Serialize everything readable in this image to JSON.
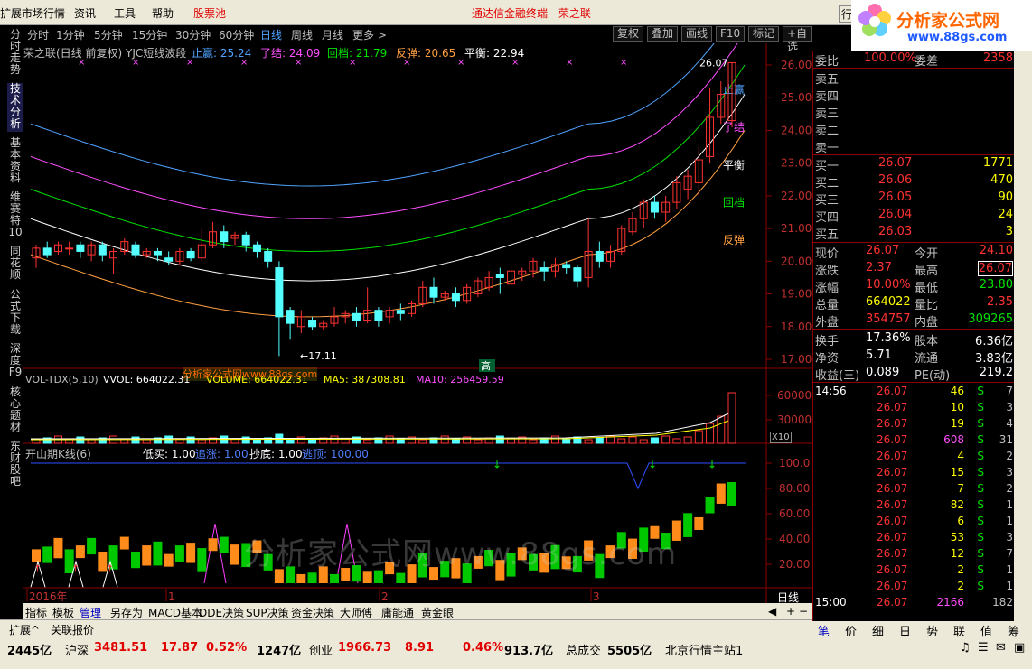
{
  "menubar": {
    "items": [
      "扩展市场行情",
      "资讯",
      "工具",
      "帮助",
      "股票池"
    ],
    "center_text": "通达信金融终端",
    "stock_name": "荣之联",
    "trade_btn": "行",
    "logo_text": "分析家公式网",
    "logo_url": "www.88gs.com"
  },
  "left_tabs": [
    "分时走势",
    "技术分析",
    "基本资料",
    "维赛特10",
    "同花顺",
    "公式下载",
    "深度F9",
    "核心题材",
    "东财股吧"
  ],
  "toolbar": {
    "periods": [
      "分时",
      "1分钟",
      "5分钟",
      "15分钟",
      "30分钟",
      "60分钟",
      "日线",
      "周线",
      "月线",
      "更多 >"
    ],
    "active": "日线",
    "buttons": [
      "复权",
      "叠加",
      "画线",
      "F10",
      "标记",
      "+自选"
    ]
  },
  "main_chart": {
    "title": "荣之联(日线 前复权) YJC短线波段",
    "legend": [
      {
        "label": "止赢: 25.24",
        "color": "#4fa3ff"
      },
      {
        "label": "了结: 24.09",
        "color": "#ff4fff"
      },
      {
        "label": "回档: 21.79",
        "color": "#00e000"
      },
      {
        "label": "反弹: 20.65",
        "color": "#ffa040"
      },
      {
        "label": "平衡: 22.94",
        "color": "#ffffff"
      }
    ],
    "y_ticks": [
      "26.00",
      "25.00",
      "24.00",
      "23.00",
      "22.00",
      "21.00",
      "20.00",
      "19.00",
      "18.00",
      "17.00"
    ],
    "line_labels": [
      "止赢",
      "了结",
      "平衡",
      "回档",
      "反弹"
    ],
    "high_label": "26.07",
    "low_label": "17.11",
    "marker_label": "高",
    "watermark": "分析家公式网www.88gs.com"
  },
  "vol_chart": {
    "legend": [
      "VOL-TDX(5,10)",
      "VVOL: 664022.31",
      "VOLUME: 664022.31",
      "MA5: 387308.81",
      "MA10: 256459.59"
    ],
    "y_ticks": [
      "60000",
      "30000"
    ],
    "unit": "X10"
  },
  "ind_chart": {
    "title": "开山期K线(6)",
    "legend": [
      {
        "label": "低买: 1.00",
        "color": "#ffffff"
      },
      {
        "label": "追涨: 1.00",
        "color": "#4f7fff"
      },
      {
        "label": "抄底: 1.00",
        "color": "#ffffff"
      },
      {
        "label": "逃顶: 100.00",
        "color": "#4f7fff"
      }
    ],
    "y_ticks": [
      "100.0",
      "80.00",
      "60.00",
      "40.00",
      "20.00"
    ]
  },
  "xaxis": {
    "labels": [
      "2016年",
      "1",
      "2",
      "3"
    ],
    "period": "日线"
  },
  "bottom_tabs": [
    "指标",
    "模板",
    "管理",
    "另存为",
    "MACD基本",
    "DDE决策",
    "SUP决策",
    "资金决策",
    "大师傅",
    "庸能通",
    "黄金眼"
  ],
  "bottom_tabs2": [
    "扩展^",
    "关联报价"
  ],
  "quote": {
    "weibi_label": "委比",
    "weibi": "100.00%",
    "weicha_label": "委差",
    "weicha": "2358",
    "sell": [
      {
        "name": "卖五",
        "price": "",
        "vol": ""
      },
      {
        "name": "卖四",
        "price": "",
        "vol": ""
      },
      {
        "name": "卖三",
        "price": "",
        "vol": ""
      },
      {
        "name": "卖二",
        "price": "",
        "vol": ""
      },
      {
        "name": "卖一",
        "price": "",
        "vol": ""
      }
    ],
    "buy": [
      {
        "name": "买一",
        "price": "26.07",
        "vol": "1771"
      },
      {
        "name": "买二",
        "price": "26.06",
        "vol": "470"
      },
      {
        "name": "买三",
        "price": "26.05",
        "vol": "90"
      },
      {
        "name": "买四",
        "price": "26.04",
        "vol": "24"
      },
      {
        "name": "买五",
        "price": "26.03",
        "vol": "3"
      }
    ],
    "stats": [
      {
        "l1": "现价",
        "v1": "26.07",
        "l2": "今开",
        "v2": "24.10"
      },
      {
        "l1": "涨跌",
        "v1": "2.37",
        "l2": "最高",
        "v2": "26.07"
      },
      {
        "l1": "涨幅",
        "v1": "10.00%",
        "l2": "最低",
        "v2": "23.80"
      },
      {
        "l1": "总量",
        "v1": "664022",
        "l2": "量比",
        "v2": "2.35"
      },
      {
        "l1": "外盘",
        "v1": "354757",
        "l2": "内盘",
        "v2": "309265"
      }
    ],
    "stats2": [
      {
        "l1": "换手",
        "v1": "17.36%",
        "l2": "股本",
        "v2": "6.36亿"
      },
      {
        "l1": "净资",
        "v1": "5.71",
        "l2": "流通",
        "v2": "3.83亿"
      },
      {
        "l1": "收益(三)",
        "v1": "0.089",
        "l2": "PE(动)",
        "v2": "219.2"
      }
    ],
    "ticks": [
      {
        "t": "14:56",
        "p": "26.07",
        "v": "46",
        "s": "S",
        "n": "7"
      },
      {
        "t": "",
        "p": "26.07",
        "v": "10",
        "s": "S",
        "n": "3"
      },
      {
        "t": "",
        "p": "26.07",
        "v": "19",
        "s": "S",
        "n": "4"
      },
      {
        "t": "",
        "p": "26.07",
        "v": "608",
        "s": "S",
        "n": "31"
      },
      {
        "t": "",
        "p": "26.07",
        "v": "4",
        "s": "S",
        "n": "2"
      },
      {
        "t": "",
        "p": "26.07",
        "v": "15",
        "s": "S",
        "n": "3"
      },
      {
        "t": "",
        "p": "26.07",
        "v": "7",
        "s": "S",
        "n": "2"
      },
      {
        "t": "",
        "p": "26.07",
        "v": "82",
        "s": "S",
        "n": "1"
      },
      {
        "t": "",
        "p": "26.07",
        "v": "6",
        "s": "S",
        "n": "1"
      },
      {
        "t": "",
        "p": "26.07",
        "v": "53",
        "s": "S",
        "n": "3"
      },
      {
        "t": "",
        "p": "26.07",
        "v": "12",
        "s": "S",
        "n": "7"
      },
      {
        "t": "",
        "p": "26.07",
        "v": "2",
        "s": "S",
        "n": "1"
      },
      {
        "t": "",
        "p": "26.07",
        "v": "2",
        "s": "S",
        "n": "1"
      },
      {
        "t": "15:00",
        "p": "26.07",
        "v": "2166",
        "s": "",
        "n": "182"
      }
    ]
  },
  "right_tabs": [
    "笔",
    "价",
    "细",
    "日",
    "势",
    "联",
    "值",
    "筹"
  ],
  "status": {
    "items": [
      {
        "label": "",
        "val": "2445亿",
        "color": "#000000"
      },
      {
        "label": "沪深",
        "val": "3481.51",
        "color": "#e00000"
      },
      {
        "label": "",
        "val": "17.87",
        "color": "#e00000"
      },
      {
        "label": "",
        "val": "0.52%",
        "color": "#e00000"
      },
      {
        "label": "",
        "val": "1247亿",
        "color": "#000000"
      },
      {
        "label": "创业",
        "val": "1966.73",
        "color": "#e00000"
      },
      {
        "label": "",
        "val": "8.91",
        "color": "#e00000"
      },
      {
        "label": "",
        "val": "0.46%",
        "color": "#e00000"
      },
      {
        "label": "",
        "val": "913.7亿",
        "color": "#000000"
      },
      {
        "label": "总成交",
        "val": "5505亿",
        "color": "#000000"
      }
    ],
    "station": "北京行情主站1"
  },
  "big_watermark": "分析家公式网www.88gs.com"
}
